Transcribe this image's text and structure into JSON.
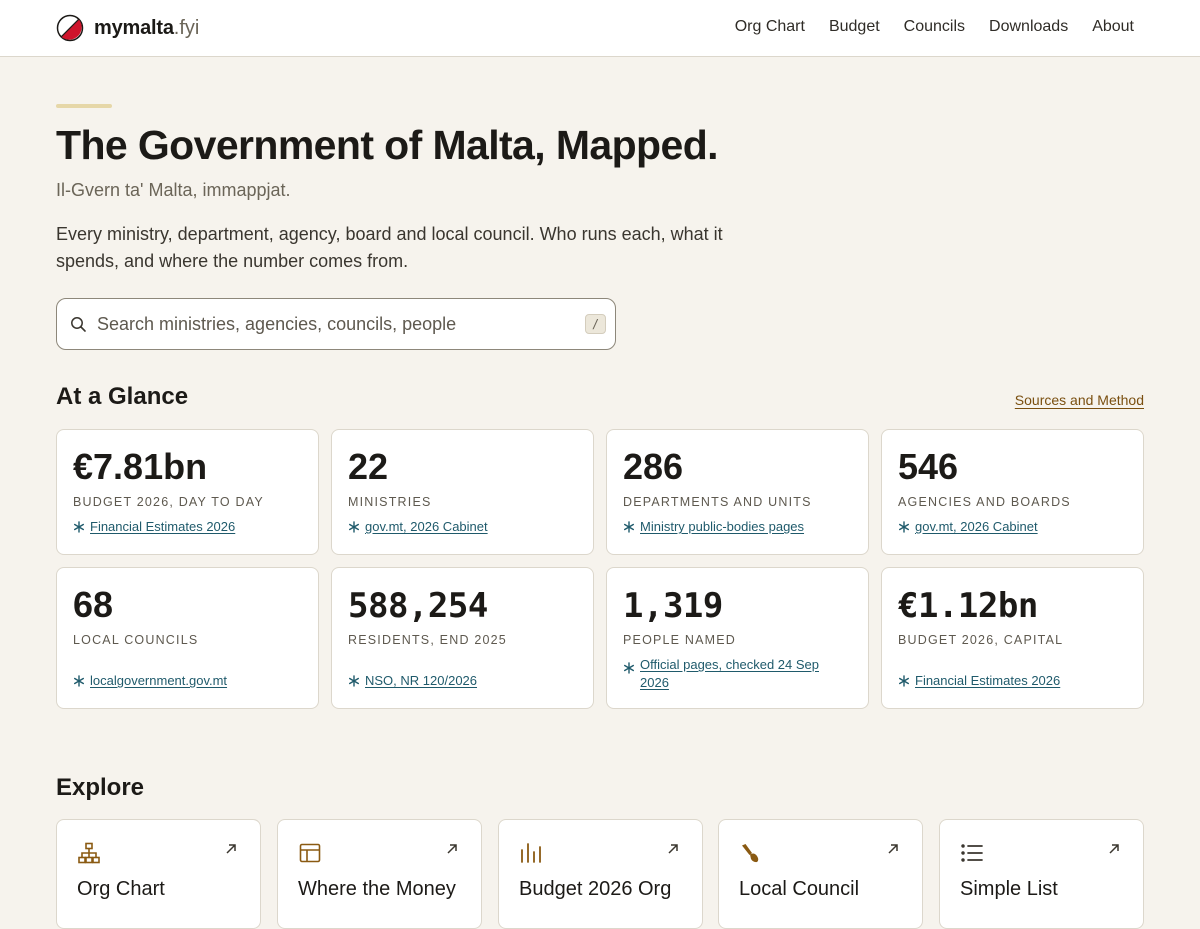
{
  "brand": {
    "name": "mymalta",
    "tld": ".fyi"
  },
  "nav": [
    "Org Chart",
    "Budget",
    "Councils",
    "Downloads",
    "About"
  ],
  "hero": {
    "title": "The Government of Malta, Mapped.",
    "subtitle": "Il-Gvern ta' Malta, immappjat.",
    "lede": "Every ministry, department, agency, board and local council. Who runs each, what it spends, and where the number comes from."
  },
  "search": {
    "placeholder": "Search ministries, agencies, councils, people",
    "value": "",
    "shortcut": "/"
  },
  "glance": {
    "heading": "At a Glance",
    "sources_link": "Sources and Method",
    "stats": [
      {
        "value": "€7.81bn",
        "label": "Budget 2026, day to day",
        "source": "Financial Estimates 2026"
      },
      {
        "value": "22",
        "label": "Ministries",
        "source": "gov.mt, 2026 Cabinet"
      },
      {
        "value": "286",
        "label": "Departments and units",
        "source": "Ministry public-bodies pages"
      },
      {
        "value": "546",
        "label": "Agencies and boards",
        "source": "gov.mt, 2026 Cabinet"
      },
      {
        "value": "68",
        "label": "Local councils",
        "source": "localgovernment.gov.mt"
      },
      {
        "value": "588,254",
        "label": "Residents, end 2025",
        "source": "NSO, NR 120/2026"
      },
      {
        "value": "1,319",
        "label": "People named",
        "source": "Official pages, checked 24 Sep 2026"
      },
      {
        "value": "€1.12bn",
        "label": "Budget 2026, capital",
        "source": "Financial Estimates 2026"
      }
    ]
  },
  "explore": {
    "heading": "Explore",
    "cards": [
      {
        "title": "Org Chart",
        "icon": "org-chart-icon"
      },
      {
        "title": "Where the Money",
        "icon": "table-icon"
      },
      {
        "title": "Budget 2026 Org",
        "icon": "bar-chart-icon"
      },
      {
        "title": "Local Council",
        "icon": "brush-icon"
      },
      {
        "title": "Simple List",
        "icon": "list-icon"
      }
    ]
  },
  "colors": {
    "accent_link": "#7a4f10",
    "source_link": "#1f5a6b",
    "background": "#f6f3ed",
    "logo_red": "#cf142b"
  }
}
